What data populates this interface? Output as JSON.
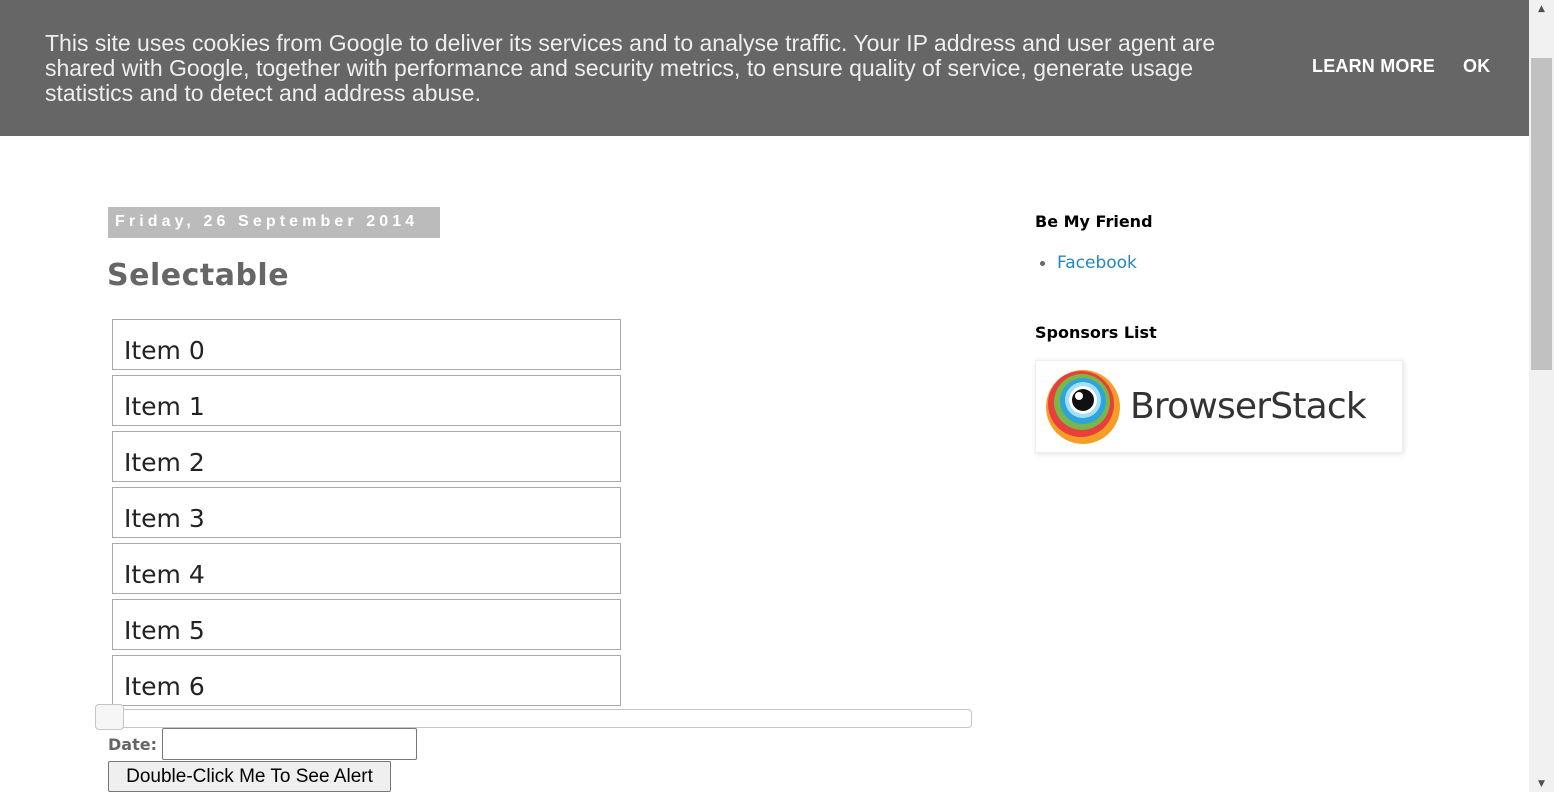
{
  "cookie_banner": {
    "text": "This site uses cookies from Google to deliver its services and to analyse traffic. Your IP address and user agent are shared with Google, together with performance and security metrics, to ensure quality of service, generate usage statistics and to detect and address abuse.",
    "learn_more_label": "LEARN MORE",
    "ok_label": "OK"
  },
  "post": {
    "date_header": "Friday, 26 September 2014",
    "title": "Selectable",
    "selectable_items": [
      "Item 0",
      "Item 1",
      "Item 2",
      "Item 3",
      "Item 4",
      "Item 5",
      "Item 6"
    ],
    "slider_value": 0,
    "date_label": "Date:",
    "date_value": "",
    "double_click_button_label": "Double-Click Me To See Alert"
  },
  "sidebar": {
    "friend_title": "Be My Friend",
    "friend_links": [
      "Facebook"
    ],
    "sponsors_title": "Sponsors List",
    "sponsor_name": "BrowserStack"
  },
  "colors": {
    "banner_bg": "#666666",
    "link": "#2288bb",
    "date_header_bg": "#bbbbbb"
  },
  "icons": {
    "scroll_up": "triangle-up-icon",
    "scroll_down": "triangle-down-icon",
    "sponsor_logo": "browserstack-logo"
  }
}
